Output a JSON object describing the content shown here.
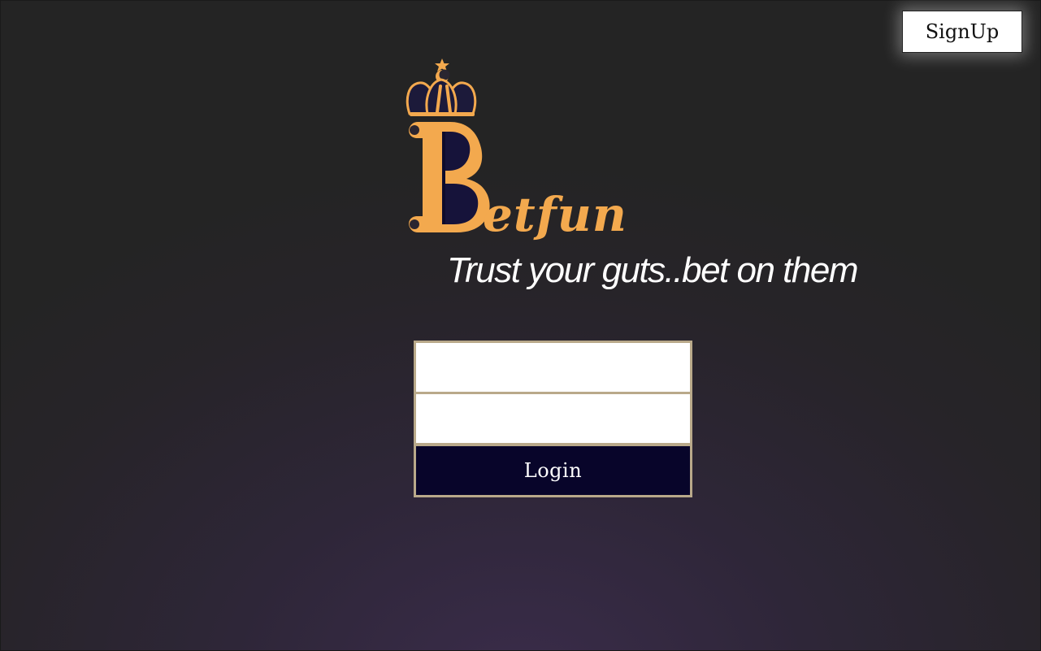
{
  "header": {
    "signup_label": "SignUp"
  },
  "logo": {
    "wordmark": "Betfun",
    "crown_icon": "crown-icon"
  },
  "tagline": "Trust your guts..bet on them",
  "login_form": {
    "username_value": "",
    "password_value": "",
    "login_label": "Login"
  },
  "colors": {
    "brand_gold": "#f3a94e",
    "button_navy": "#08052a",
    "form_border": "#b9a98a"
  }
}
